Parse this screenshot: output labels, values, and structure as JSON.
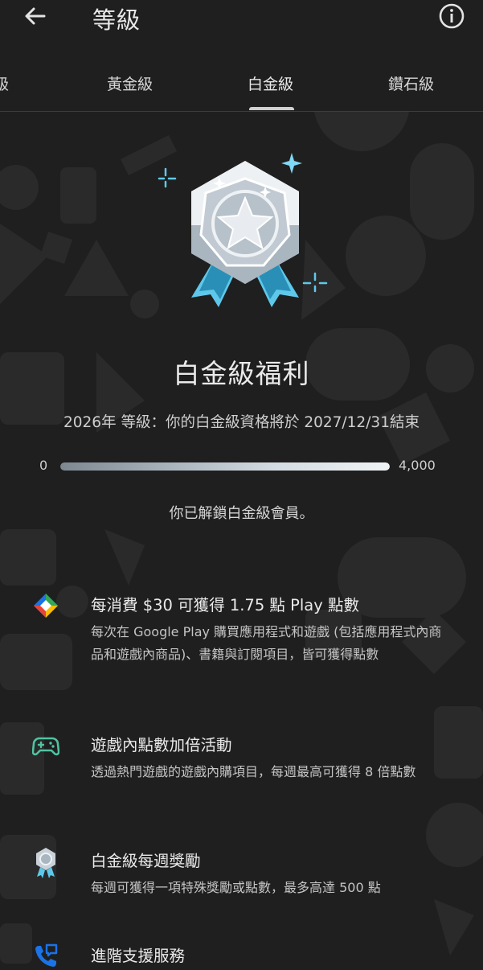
{
  "app_bar": {
    "title": "等級",
    "back_icon": "arrow-left-icon",
    "info_icon": "info-icon"
  },
  "tabs": [
    {
      "label": "級",
      "active": false
    },
    {
      "label": "黃金級",
      "active": false
    },
    {
      "label": "白金級",
      "active": true
    },
    {
      "label": "鑽石級",
      "active": false
    }
  ],
  "tier": {
    "heading": "白金級福利",
    "status_line": "2026年 等級：你的白金級資格將於 2027/12/31結束",
    "progress": {
      "start_label": "0",
      "end_label": "4,000",
      "fill_fraction": 1.0
    },
    "unlocked_message": "你已解鎖白金級會員。"
  },
  "benefits": [
    {
      "icon": "play-points-icon",
      "title": "每消費 $30 可獲得 1.75 點 Play 點數",
      "desc": "每次在 Google Play 購買應用程式和遊戲 (包括應用程式內商品和遊戲內商品)、書籍與訂閱項目，皆可獲得點數"
    },
    {
      "icon": "gamepad-icon",
      "title": "遊戲內點數加倍活動",
      "desc": "透過熱門遊戲的遊戲內購項目，每週最高可獲得 8 倍點數"
    },
    {
      "icon": "platinum-medal-icon",
      "title": "白金級每週獎勵",
      "desc": "每週可獲得一項特殊獎勵或點數，最多高達 500 點"
    },
    {
      "icon": "support-phone-icon",
      "title": "進階支援服務",
      "desc": ""
    }
  ],
  "colors": {
    "background": "#1f1f1f",
    "text_primary": "#eaeaea",
    "gamepad_green": "#4fc3a1",
    "medal_ribbon_blue": "#5ec8ea",
    "support_blue": "#1a73e8"
  }
}
